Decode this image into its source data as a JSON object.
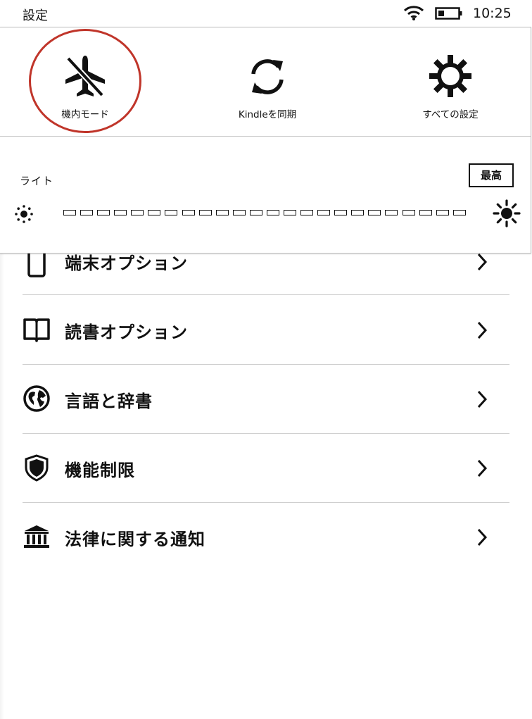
{
  "status_bar": {
    "title": "設定",
    "time": "10:25",
    "wifi_icon": "wifi-icon",
    "battery_icon": "battery-low-icon"
  },
  "quick_actions": [
    {
      "label": "機内モード",
      "icon": "airplane-icon",
      "highlighted": true
    },
    {
      "label": "Kindleを同期",
      "icon": "sync-icon"
    },
    {
      "label": "すべての設定",
      "icon": "gear-icon"
    }
  ],
  "light": {
    "label": "ライト",
    "max_button_label": "最高",
    "level": 0,
    "segments": 24
  },
  "settings_list": [
    {
      "label": "端末オプション",
      "icon": "device-icon"
    },
    {
      "label": "読書オプション",
      "icon": "book-icon"
    },
    {
      "label": "言語と辞書",
      "icon": "globe-icon"
    },
    {
      "label": "機能制限",
      "icon": "shield-icon"
    },
    {
      "label": "法律に関する通知",
      "icon": "courthouse-icon"
    }
  ],
  "colors": {
    "highlight_circle": "#c0352a",
    "text": "#111111",
    "divider": "#cfcfcf"
  }
}
